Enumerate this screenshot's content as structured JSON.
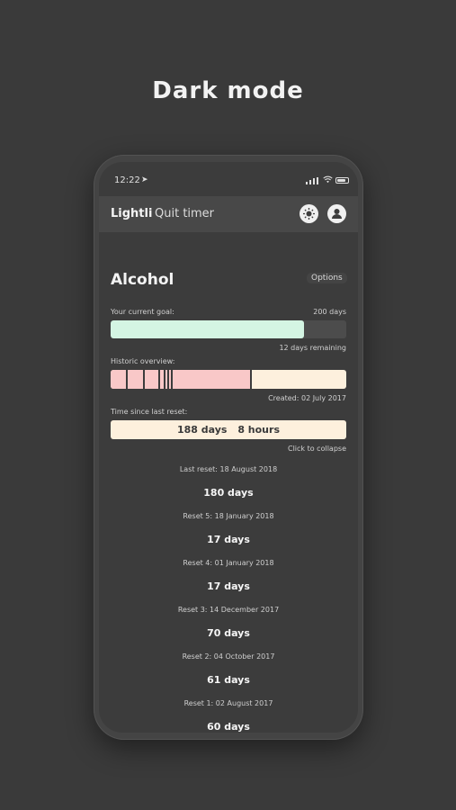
{
  "headline": "Dark mode",
  "status_bar": {
    "time": "12:22"
  },
  "header": {
    "app_name": "Lightli",
    "subtitle": "Quit timer"
  },
  "tracker": {
    "title": "Alcohol",
    "options_label": "Options",
    "goal": {
      "label": "Your current goal:",
      "target": "200 days",
      "remaining": "12 days remaining",
      "progress_fraction": 0.82,
      "fill_color": "#d4f5e3"
    },
    "historic": {
      "label": "Historic overview:",
      "created": "Created: 02 July 2017",
      "reset_color": "#f9c8c8",
      "current_color": "#fdf0dd"
    },
    "since_reset": {
      "label": "Time since last reset:",
      "days": "188 days",
      "hours": "8 hours",
      "collapse": "Click to collapse"
    },
    "history": [
      {
        "label": "Last reset: 18 August 2018",
        "value": "180 days"
      },
      {
        "label": "Reset 5: 18 January 2018",
        "value": "17 days"
      },
      {
        "label": "Reset 4: 01 January 2018",
        "value": "17 days"
      },
      {
        "label": "Reset 3: 14 December 2017",
        "value": "70 days"
      },
      {
        "label": "Reset 2: 04 October 2017",
        "value": "61 days"
      },
      {
        "label": "Reset 1: 02 August 2017",
        "value": "60 days"
      }
    ]
  },
  "colors": {
    "background": "#3a3a3a",
    "screen": "#3c3c3c",
    "header": "#484848"
  }
}
